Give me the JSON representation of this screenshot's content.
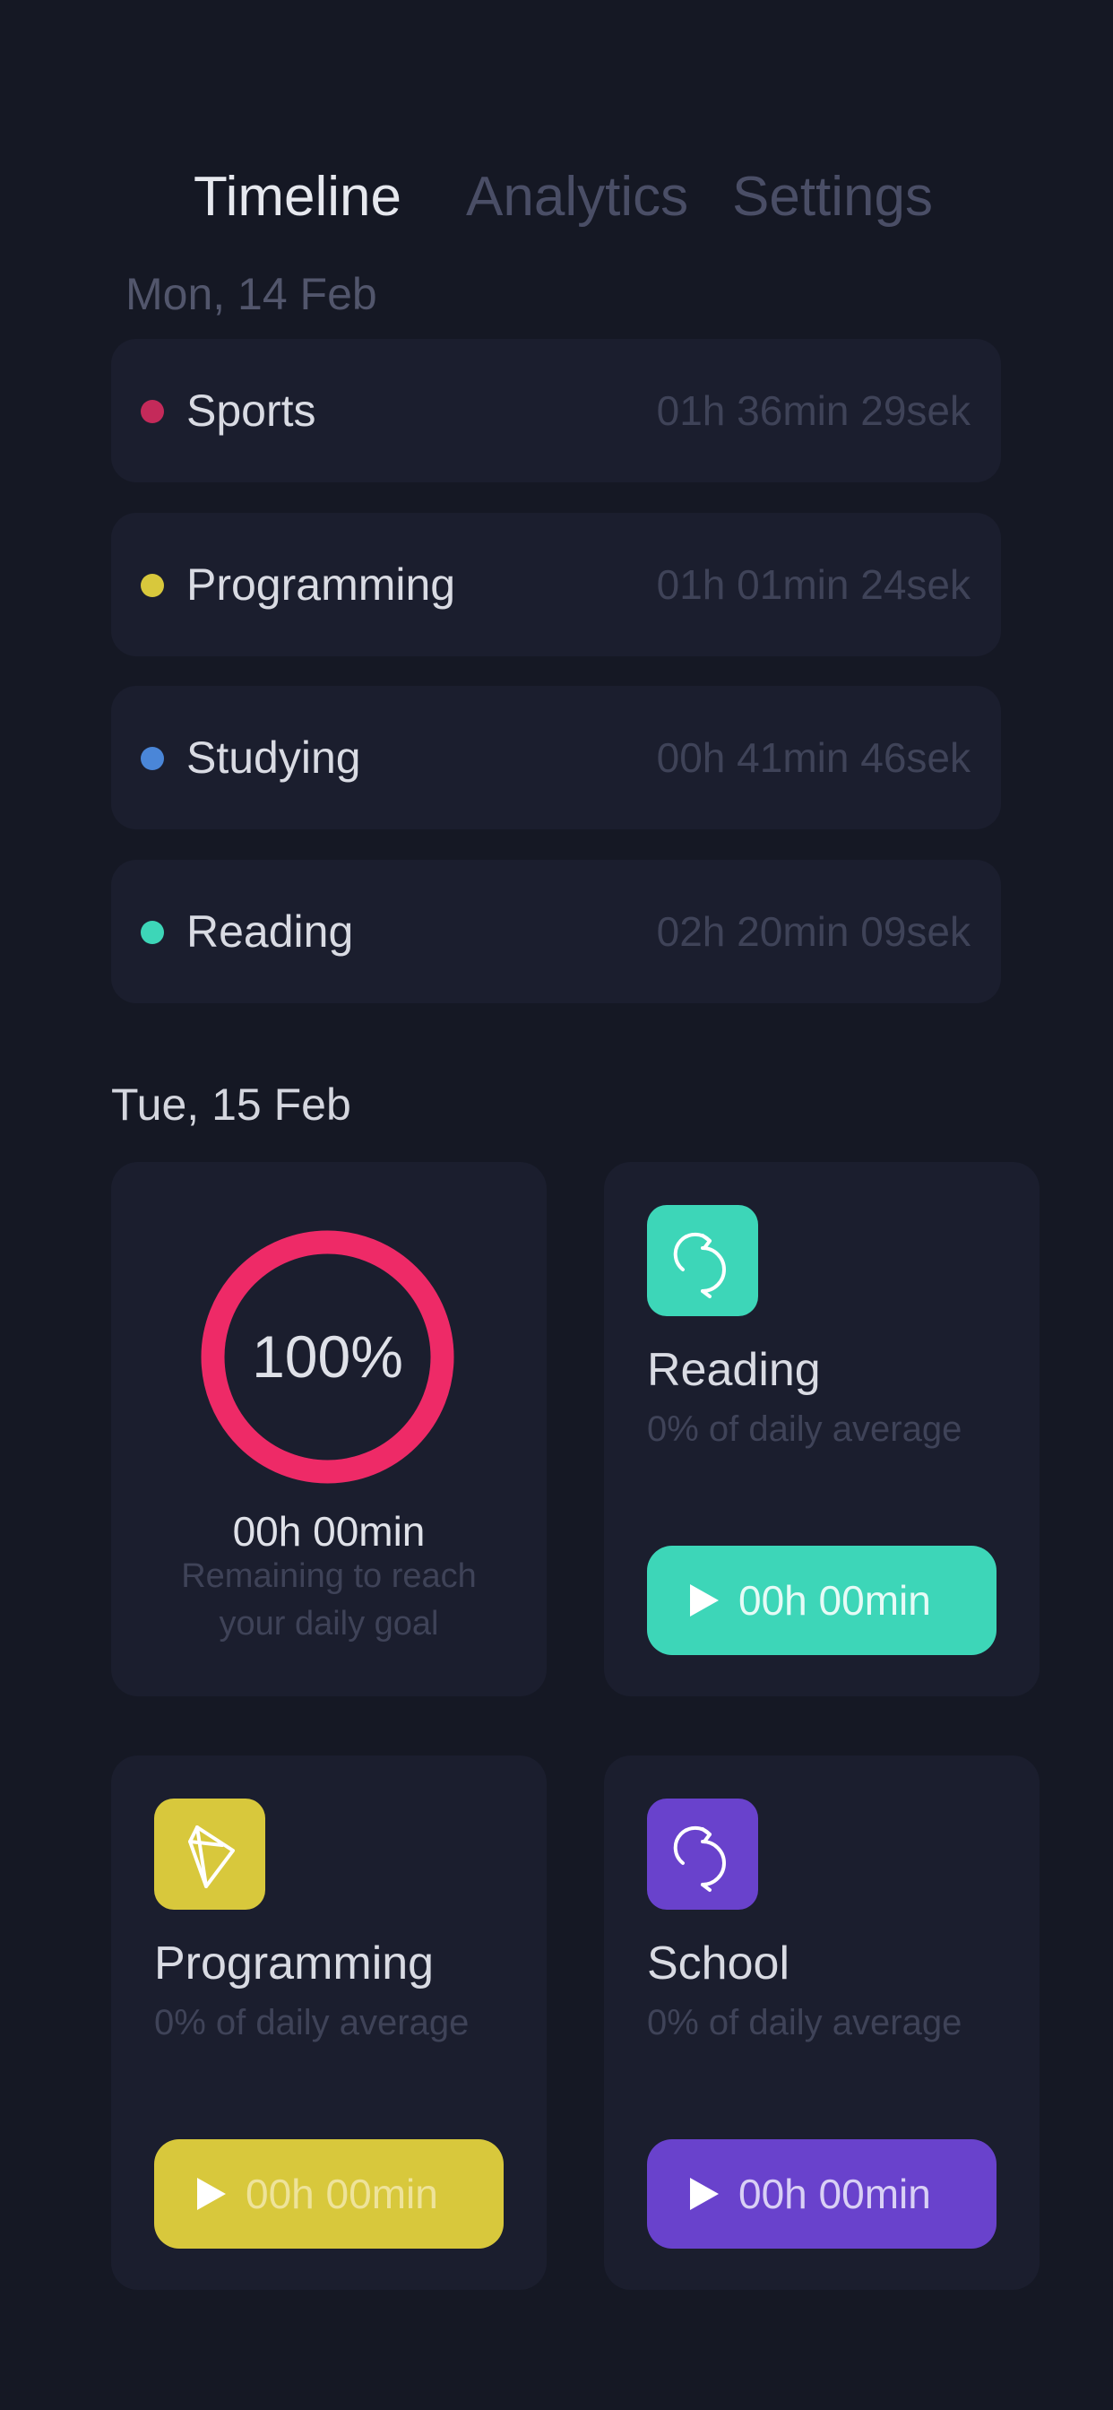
{
  "tabs": [
    {
      "label": "Timeline"
    },
    {
      "label": "Analytics"
    },
    {
      "label": "Settings"
    }
  ],
  "timeline": {
    "date": "Mon, 14 Feb",
    "entries": [
      {
        "name": "Sports",
        "time": "01h 36min 29sek",
        "color": "#c42a5a"
      },
      {
        "name": "Programming",
        "time": "01h 01min 24sek",
        "color": "#d8c83c"
      },
      {
        "name": "Studying",
        "time": "00h 41min 46sek",
        "color": "#4a86d8"
      },
      {
        "name": "Reading",
        "time": "02h 20min 09sek",
        "color": "#3dd6b8"
      }
    ]
  },
  "today": {
    "date": "Tue, 15 Feb",
    "goal": {
      "percent_label": "100%",
      "progress": 1.0,
      "ring_color": "#ee2a67",
      "remaining": "00h 00min",
      "caption": "Remaining to reach your daily goal"
    },
    "activities": [
      {
        "title": "Reading",
        "subtitle": "0% of daily average",
        "button_label": "00h 00min",
        "color": "#3dd6b8",
        "icon": "refresh-icon"
      },
      {
        "title": "Programming",
        "subtitle": "0% of daily average",
        "button_label": "00h 00min",
        "color": "#d8c83c",
        "icon": "compass-icon"
      },
      {
        "title": "School",
        "subtitle": "0% of daily average",
        "button_label": "00h 00min",
        "color": "#6942cc",
        "icon": "refresh-icon"
      }
    ]
  }
}
